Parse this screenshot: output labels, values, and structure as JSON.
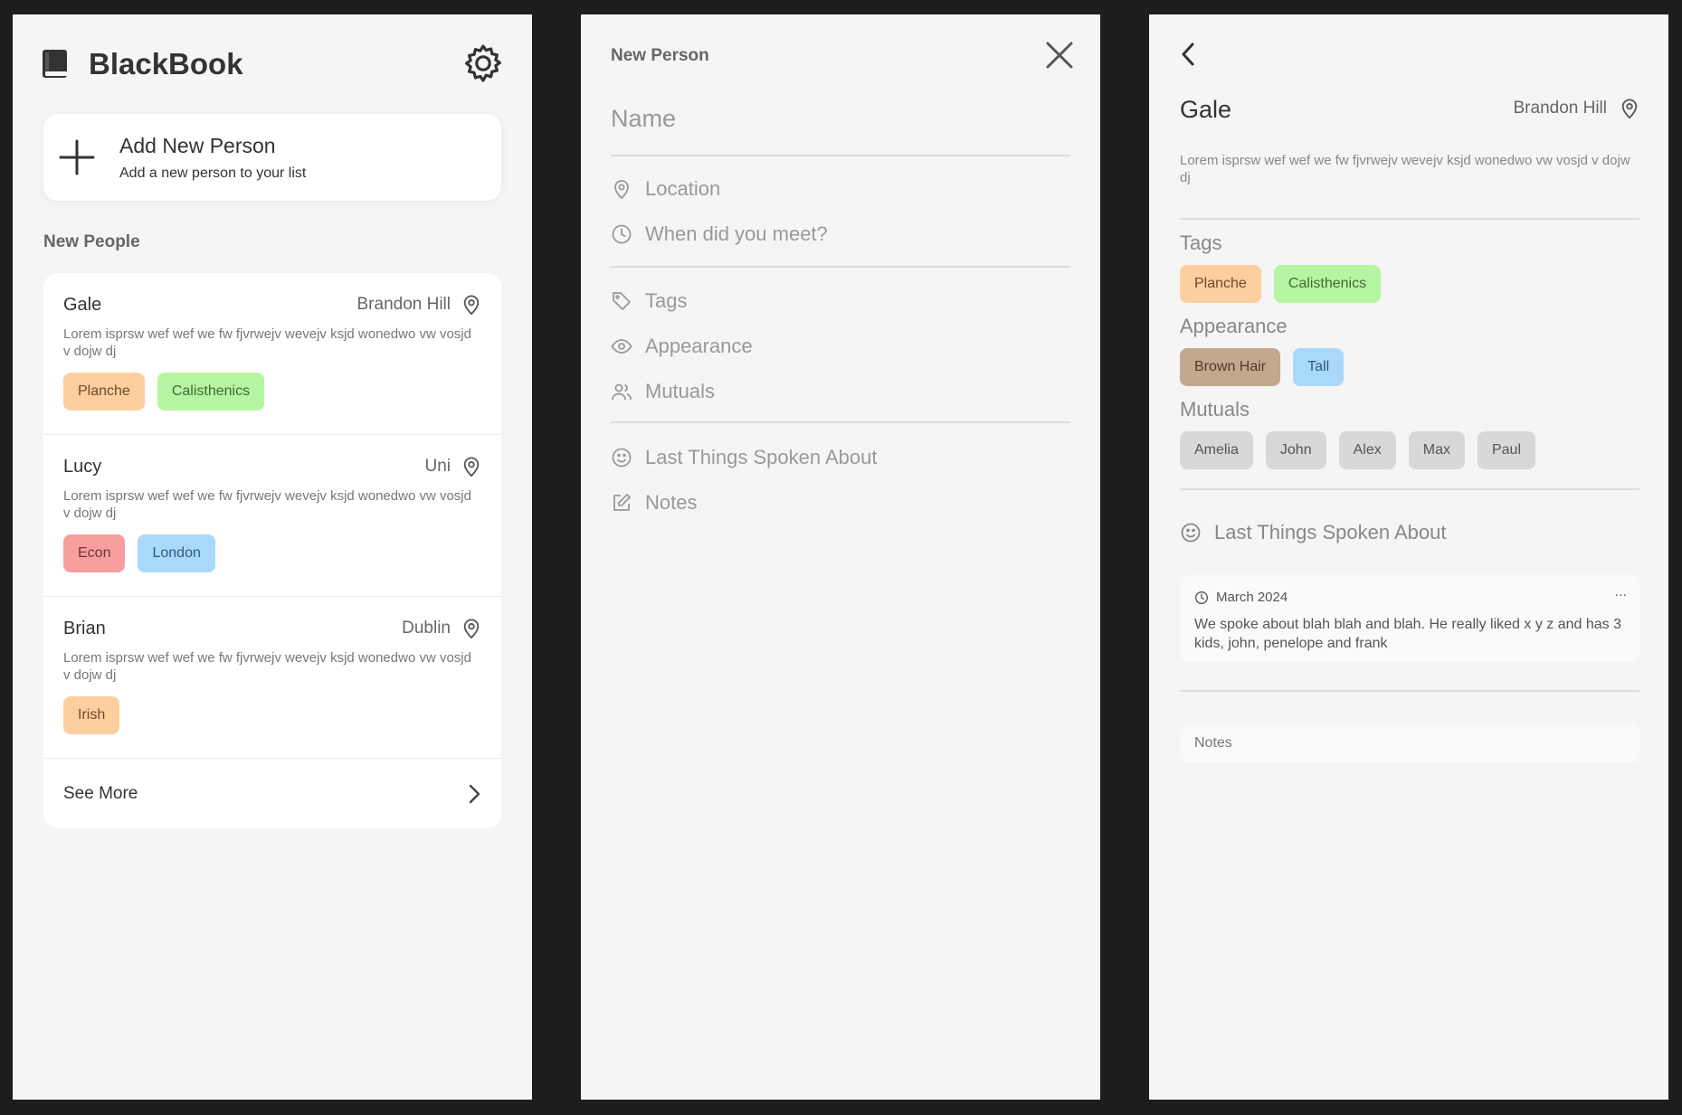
{
  "home": {
    "app_title": "BlackBook",
    "add_card": {
      "title": "Add New Person",
      "subtitle": "Add a new person to your list"
    },
    "section_title": "New People",
    "people": [
      {
        "name": "Gale",
        "location": "Brandon Hill",
        "description": "Lorem isprsw wef wef we fw fjvrwejv wevejv ksjd wonedwo vw vosjd v dojw dj",
        "tags": [
          {
            "label": "Planche",
            "bg": "#fdcf9f",
            "fg": "#6b4a28"
          },
          {
            "label": "Calisthenics",
            "bg": "#b6f6a3",
            "fg": "#3e6b31"
          }
        ]
      },
      {
        "name": "Lucy",
        "location": "Uni",
        "description": "Lorem isprsw wef wef we fw fjvrwejv wevejv ksjd wonedwo vw vosjd v dojw dj",
        "tags": [
          {
            "label": "Econ",
            "bg": "#f79f9f",
            "fg": "#6f3333"
          },
          {
            "label": "London",
            "bg": "#a9d8fb",
            "fg": "#2f5b78"
          }
        ]
      },
      {
        "name": "Brian",
        "location": "Dublin",
        "description": "Lorem isprsw wef wef we fw fjvrwejv wevejv ksjd wonedwo vw vosjd v dojw dj",
        "tags": [
          {
            "label": "Irish",
            "bg": "#fdcf9f",
            "fg": "#6b4a28"
          }
        ]
      }
    ],
    "see_more": "See More"
  },
  "new_person": {
    "title": "New Person",
    "name_placeholder": "Name",
    "fields": {
      "location": "Location",
      "met": "When did you meet?",
      "tags": "Tags",
      "appearance": "Appearance",
      "mutuals": "Mutuals",
      "last_spoken": "Last Things Spoken About",
      "notes": "Notes"
    }
  },
  "detail": {
    "name": "Gale",
    "location": "Brandon Hill",
    "description": "Lorem isprsw wef wef we fw fjvrwejv wevejv ksjd wonedwo vw vosjd v dojw dj",
    "tags_label": "Tags",
    "tags": [
      {
        "label": "Planche",
        "bg": "#fdcf9f",
        "fg": "#6b4a28"
      },
      {
        "label": "Calisthenics",
        "bg": "#b6f6a3",
        "fg": "#3e6b31"
      }
    ],
    "appearance_label": "Appearance",
    "appearance": [
      {
        "label": "Brown Hair",
        "bg": "#c4a88e",
        "fg": "#4e3a28"
      },
      {
        "label": "Tall",
        "bg": "#a9d8fb",
        "fg": "#2f5b78"
      }
    ],
    "mutuals_label": "Mutuals",
    "mutuals": [
      {
        "label": "Amelia",
        "bg": "#d8d8d8",
        "fg": "#555555"
      },
      {
        "label": "John",
        "bg": "#d8d8d8",
        "fg": "#555555"
      },
      {
        "label": "Alex",
        "bg": "#d8d8d8",
        "fg": "#555555"
      },
      {
        "label": "Max",
        "bg": "#d8d8d8",
        "fg": "#555555"
      },
      {
        "label": "Paul",
        "bg": "#d8d8d8",
        "fg": "#555555"
      }
    ],
    "last_spoken_label": "Last Things Spoken About",
    "note": {
      "date": "March 2024",
      "more": "...",
      "text": "We spoke about blah blah and blah. He really liked x y z and has 3 kids, john, penelope and frank"
    },
    "notes_label": "Notes"
  }
}
